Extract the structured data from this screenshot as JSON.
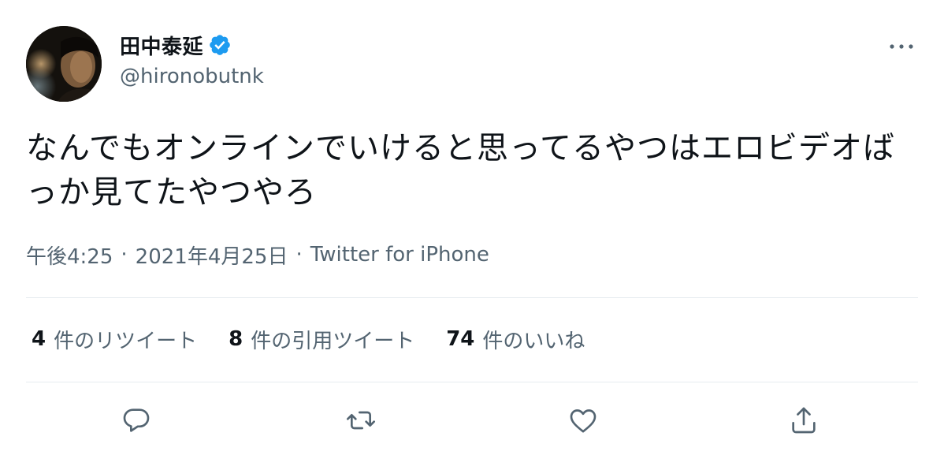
{
  "author": {
    "display_name": "田中泰延",
    "handle": "@hironobutnk",
    "verified": true,
    "avatar_icon": "profile-photo"
  },
  "tweet": {
    "text": "なんでもオンラインでいけると思ってるやつはエロビデオばっか見てたやつやろ",
    "time": "午後4:25",
    "separator": "·",
    "date": "2021年4月25日",
    "source": "Twitter for iPhone"
  },
  "stats": {
    "retweets": {
      "count": "4",
      "label": "件のリツイート"
    },
    "quotes": {
      "count": "8",
      "label": "件の引用ツイート"
    },
    "likes": {
      "count": "74",
      "label": "件のいいね"
    }
  },
  "actions": [
    "reply-icon",
    "retweet-icon",
    "like-icon",
    "share-icon"
  ],
  "colors": {
    "text_primary": "#0f1419",
    "text_secondary": "#536471",
    "verified_blue": "#1d9bf0",
    "divider": "#e6ecf0"
  }
}
